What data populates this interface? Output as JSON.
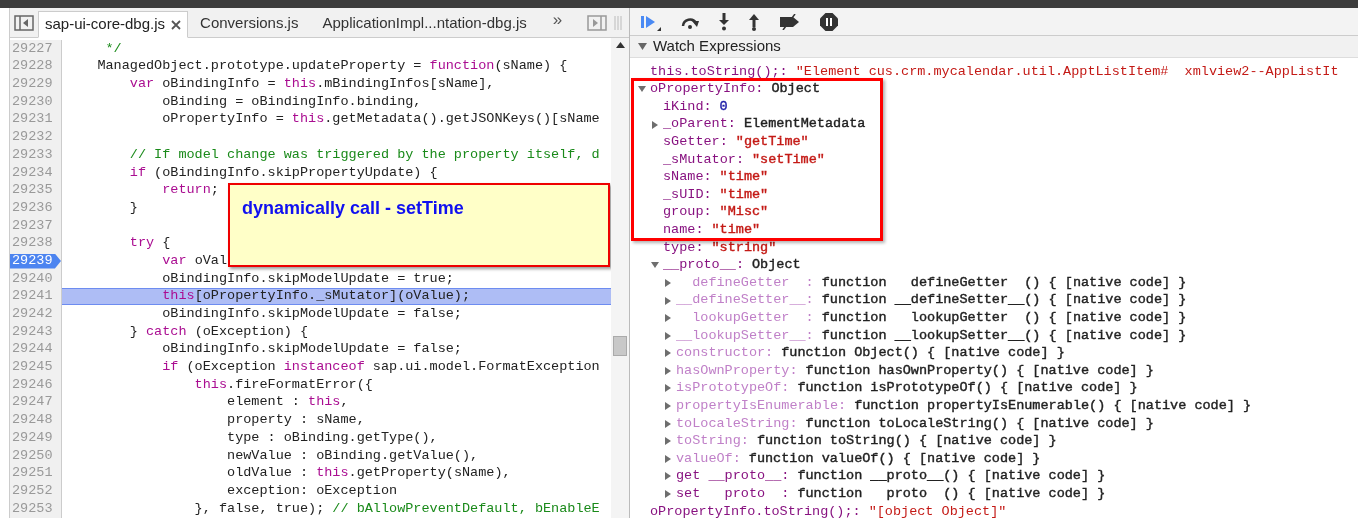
{
  "tabs": [
    {
      "label": "sap-ui-core-dbg.js",
      "selected": true
    },
    {
      "label": "Conversions.js",
      "selected": false
    },
    {
      "label": "ApplicationImpl...ntation-dbg.js",
      "selected": false
    }
  ],
  "more_tabs": "»",
  "code": [
    {
      "number": "29227",
      "breakpoint": false,
      "current": false,
      "tokens": [
        {
          "kind": "comment",
          "text": "     */"
        }
      ]
    },
    {
      "number": "29228",
      "breakpoint": false,
      "current": false,
      "tokens": [
        {
          "kind": "plain",
          "text": "    ManagedObject.prototype.updateProperty = "
        },
        {
          "kind": "keyword",
          "text": "function"
        },
        {
          "kind": "plain",
          "text": "(sName) {"
        }
      ]
    },
    {
      "number": "29229",
      "breakpoint": false,
      "current": false,
      "tokens": [
        {
          "kind": "keyword",
          "text": "        var"
        },
        {
          "kind": "plain",
          "text": " oBindingInfo = "
        },
        {
          "kind": "keyword",
          "text": "this"
        },
        {
          "kind": "plain",
          "text": ".mBindingInfos[sName],"
        }
      ]
    },
    {
      "number": "29230",
      "breakpoint": false,
      "current": false,
      "tokens": [
        {
          "kind": "plain",
          "text": "            oBinding = oBindingInfo.binding,"
        }
      ]
    },
    {
      "number": "29231",
      "breakpoint": false,
      "current": false,
      "tokens": [
        {
          "kind": "plain",
          "text": "            oPropertyInfo = "
        },
        {
          "kind": "keyword",
          "text": "this"
        },
        {
          "kind": "plain",
          "text": ".getMetadata().getJSONKeys()[sName"
        }
      ]
    },
    {
      "number": "29232",
      "breakpoint": false,
      "current": false
    },
    {
      "number": "29233",
      "breakpoint": false,
      "current": false,
      "tokens": [
        {
          "kind": "comment",
          "text": "        // If model change was triggered by the property itself, d"
        }
      ]
    },
    {
      "number": "29234",
      "breakpoint": false,
      "current": false,
      "tokens": [
        {
          "kind": "keyword",
          "text": "        if"
        },
        {
          "kind": "plain",
          "text": " (oBindingInfo.skipPropertyUpdate) {"
        }
      ]
    },
    {
      "number": "29235",
      "breakpoint": false,
      "current": false,
      "tokens": [
        {
          "kind": "keyword",
          "text": "            return"
        },
        {
          "kind": "plain",
          "text": ";"
        }
      ]
    },
    {
      "number": "29236",
      "breakpoint": false,
      "current": false,
      "tokens": [
        {
          "kind": "plain",
          "text": "        }"
        }
      ]
    },
    {
      "number": "29237",
      "breakpoint": false,
      "current": false
    },
    {
      "number": "29238",
      "breakpoint": false,
      "current": false,
      "tokens": [
        {
          "kind": "keyword",
          "text": "        try"
        },
        {
          "kind": "plain",
          "text": " {"
        }
      ]
    },
    {
      "number": "29239",
      "breakpoint": true,
      "current": false,
      "tokens": [
        {
          "kind": "keyword",
          "text": "            var"
        },
        {
          "kind": "plain",
          "text": " oVal"
        }
      ]
    },
    {
      "number": "29240",
      "breakpoint": false,
      "current": false,
      "tokens": [
        {
          "kind": "plain",
          "text": "            oBindingInfo.skipModelUpdate = true;"
        }
      ]
    },
    {
      "number": "29241",
      "breakpoint": false,
      "current": true,
      "tokens": [
        {
          "kind": "keyword",
          "text": "            this"
        },
        {
          "kind": "plain",
          "text": "[oPropertyInfo._sMutator](oValue);"
        }
      ]
    },
    {
      "number": "29242",
      "breakpoint": false,
      "current": false,
      "tokens": [
        {
          "kind": "plain",
          "text": "            oBindingInfo.skipModelUpdate = false;"
        }
      ]
    },
    {
      "number": "29243",
      "breakpoint": false,
      "current": false,
      "tokens": [
        {
          "kind": "plain",
          "text": "        } "
        },
        {
          "kind": "keyword",
          "text": "catch"
        },
        {
          "kind": "plain",
          "text": " (oException) {"
        }
      ]
    },
    {
      "number": "29244",
      "breakpoint": false,
      "current": false,
      "tokens": [
        {
          "kind": "plain",
          "text": "            oBindingInfo.skipModelUpdate = false;"
        }
      ]
    },
    {
      "number": "29245",
      "breakpoint": false,
      "current": false,
      "tokens": [
        {
          "kind": "keyword",
          "text": "            if"
        },
        {
          "kind": "plain",
          "text": " (oException "
        },
        {
          "kind": "keyword",
          "text": "instanceof"
        },
        {
          "kind": "plain",
          "text": " sap.ui.model.FormatException"
        }
      ]
    },
    {
      "number": "29246",
      "breakpoint": false,
      "current": false,
      "tokens": [
        {
          "kind": "keyword",
          "text": "                this"
        },
        {
          "kind": "plain",
          "text": ".fireFormatError({"
        }
      ]
    },
    {
      "number": "29247",
      "breakpoint": false,
      "current": false,
      "tokens": [
        {
          "kind": "plain",
          "text": "                    element : "
        },
        {
          "kind": "keyword",
          "text": "this"
        },
        {
          "kind": "plain",
          "text": ","
        }
      ]
    },
    {
      "number": "29248",
      "breakpoint": false,
      "current": false,
      "tokens": [
        {
          "kind": "plain",
          "text": "                    property : sName,"
        }
      ]
    },
    {
      "number": "29249",
      "breakpoint": false,
      "current": false,
      "tokens": [
        {
          "kind": "plain",
          "text": "                    type : oBinding.getType(),"
        }
      ]
    },
    {
      "number": "29250",
      "breakpoint": false,
      "current": false,
      "tokens": [
        {
          "kind": "plain",
          "text": "                    newValue : oBinding.getValue(),"
        }
      ]
    },
    {
      "number": "29251",
      "breakpoint": false,
      "current": false,
      "tokens": [
        {
          "kind": "plain",
          "text": "                    oldValue : "
        },
        {
          "kind": "keyword",
          "text": "this"
        },
        {
          "kind": "plain",
          "text": ".getProperty(sName),"
        }
      ]
    },
    {
      "number": "29252",
      "breakpoint": false,
      "current": false,
      "tokens": [
        {
          "kind": "plain",
          "text": "                    exception: oException"
        }
      ]
    },
    {
      "number": "29253",
      "breakpoint": false,
      "current": false,
      "tokens": [
        {
          "kind": "plain",
          "text": "                }, false, true); "
        },
        {
          "kind": "comment",
          "text": "// bAllowPreventDefault, bEnableE"
        }
      ]
    }
  ],
  "annotation": {
    "text": "dynamically call - setTime"
  },
  "watch": {
    "title": "Watch Expressions",
    "expanded": true,
    "items": [
      {
        "kind": "expression",
        "name": "this.toString();:",
        "value": "\"Element cus.crm.mycalendar.util.ApptListItem#  xmlview2--AppListIt"
      },
      {
        "kind": "branch",
        "name": "oPropertyInfo:",
        "value": "Object",
        "expanded": true,
        "children": [
          {
            "kind": "leaf",
            "name": "iKind:",
            "value": "0",
            "color": "#1a1aa6",
            "dimmed": false
          },
          {
            "kind": "branch",
            "name": "_oParent:",
            "value": "ElementMetadata",
            "color": "#222222",
            "dimmed": false,
            "expanded": false
          },
          {
            "kind": "leaf",
            "name": "sGetter:",
            "value": "\"getTime\"",
            "color": "#c41a16",
            "dimmed": false
          },
          {
            "kind": "leaf",
            "name": "_sMutator:",
            "value": "\"setTime\"",
            "color": "#c41a16",
            "dimmed": false
          },
          {
            "kind": "leaf",
            "name": "sName:",
            "value": "\"time\"",
            "color": "#c41a16",
            "dimmed": false
          },
          {
            "kind": "leaf",
            "name": "_sUID:",
            "value": "\"time\"",
            "color": "#c41a16",
            "dimmed": false
          },
          {
            "kind": "leaf",
            "name": "group:",
            "value": "\"Misc\"",
            "color": "#c41a16",
            "dimmed": false
          },
          {
            "kind": "leaf",
            "name": "name:",
            "value": "\"time\"",
            "color": "#c41a16",
            "dimmed": false
          },
          {
            "kind": "leaf",
            "name": "type:",
            "value": "\"string\"",
            "color": "#c41a16",
            "dimmed": false
          },
          {
            "kind": "branch",
            "name": "__proto__:",
            "value": "Object",
            "color": "#222222",
            "dimmed": false,
            "expanded": true,
            "children": [
              {
                "kind": "branch",
                "name": "  defineGetter  :",
                "value": "function   defineGetter  () { [native code] }",
                "color": "#222222",
                "dimmed": true,
                "expanded": false
              },
              {
                "kind": "branch",
                "name": "__defineSetter__:",
                "value": "function __defineSetter__() { [native code] }",
                "color": "#222222",
                "dimmed": true,
                "expanded": false
              },
              {
                "kind": "branch",
                "name": "  lookupGetter  :",
                "value": "function   lookupGetter  () { [native code] }",
                "color": "#222222",
                "dimmed": true,
                "expanded": false
              },
              {
                "kind": "branch",
                "name": "__lookupSetter__:",
                "value": "function __lookupSetter__() { [native code] }",
                "color": "#222222",
                "dimmed": true,
                "expanded": false
              },
              {
                "kind": "branch",
                "name": "constructor:",
                "value": "function Object() { [native code] }",
                "color": "#222222",
                "dimmed": true,
                "expanded": false
              },
              {
                "kind": "branch",
                "name": "hasOwnProperty:",
                "value": "function hasOwnProperty() { [native code] }",
                "color": "#222222",
                "dimmed": true,
                "expanded": false
              },
              {
                "kind": "branch",
                "name": "isPrototypeOf:",
                "value": "function isPrototypeOf() { [native code] }",
                "color": "#222222",
                "dimmed": true,
                "expanded": false
              },
              {
                "kind": "branch",
                "name": "propertyIsEnumerable:",
                "value": "function propertyIsEnumerable() { [native code] }",
                "color": "#222222",
                "dimmed": true,
                "expanded": false
              },
              {
                "kind": "branch",
                "name": "toLocaleString:",
                "value": "function toLocaleString() { [native code] }",
                "color": "#222222",
                "dimmed": true,
                "expanded": false
              },
              {
                "kind": "branch",
                "name": "toString:",
                "value": "function toString() { [native code] }",
                "color": "#222222",
                "dimmed": true,
                "expanded": false
              },
              {
                "kind": "branch",
                "name": "valueOf:",
                "value": "function valueOf() { [native code] }",
                "color": "#222222",
                "dimmed": true,
                "expanded": false
              },
              {
                "kind": "branch",
                "name": "get __proto__:",
                "value": "function __proto__() { [native code] }",
                "color": "#222222",
                "dimmed": false,
                "expanded": false
              },
              {
                "kind": "branch",
                "name": "set   proto  :",
                "value": "function   proto  () { [native code] }",
                "color": "#222222",
                "dimmed": false,
                "expanded": false
              }
            ]
          }
        ]
      },
      {
        "kind": "expression",
        "name": "oPropertyInfo.toString();:",
        "value": "\"[object Object]\""
      }
    ]
  }
}
